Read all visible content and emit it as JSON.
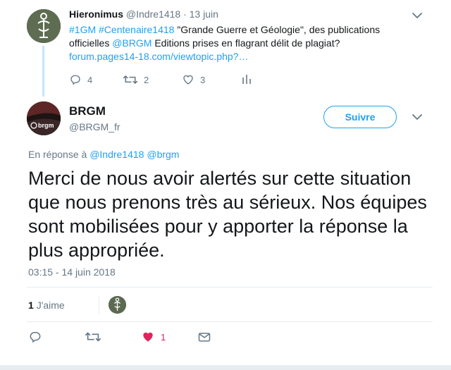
{
  "parent_tweet": {
    "name": "Hieronimus",
    "handle": "@Indre1418",
    "separator": "·",
    "date": "13 juin",
    "text_parts": {
      "hashtags": "#1GM #Centenaire1418",
      "text1": " \"Grande Guerre et Géologie\", des publications officielles ",
      "mention": "@BRGM",
      "text2": " Editions prises en flagrant délit de plagiat?",
      "url": "forum.pages14-18.com/viewtopic.php?…"
    },
    "replies": "4",
    "retweets": "2",
    "likes": "3"
  },
  "main_tweet": {
    "name": "BRGM",
    "handle": "@BRGM_fr",
    "follow_label": "Suivre",
    "reply_prefix": "En réponse à",
    "reply_to_1": "@Indre1418",
    "reply_to_2": "@brgm",
    "text": "Merci de nous avoir alertés sur cette situation que nous prenons très au sérieux. Nos équipes sont mobilisées pour y apporter la réponse la plus appropriée.",
    "timestamp": "03:15 - 14 juin 2018",
    "like_count": "1",
    "like_label": "J'aime",
    "action_like_count": "1"
  },
  "colors": {
    "accent": "#1da1f2",
    "like_red": "#e0245e",
    "muted": "#657786"
  }
}
